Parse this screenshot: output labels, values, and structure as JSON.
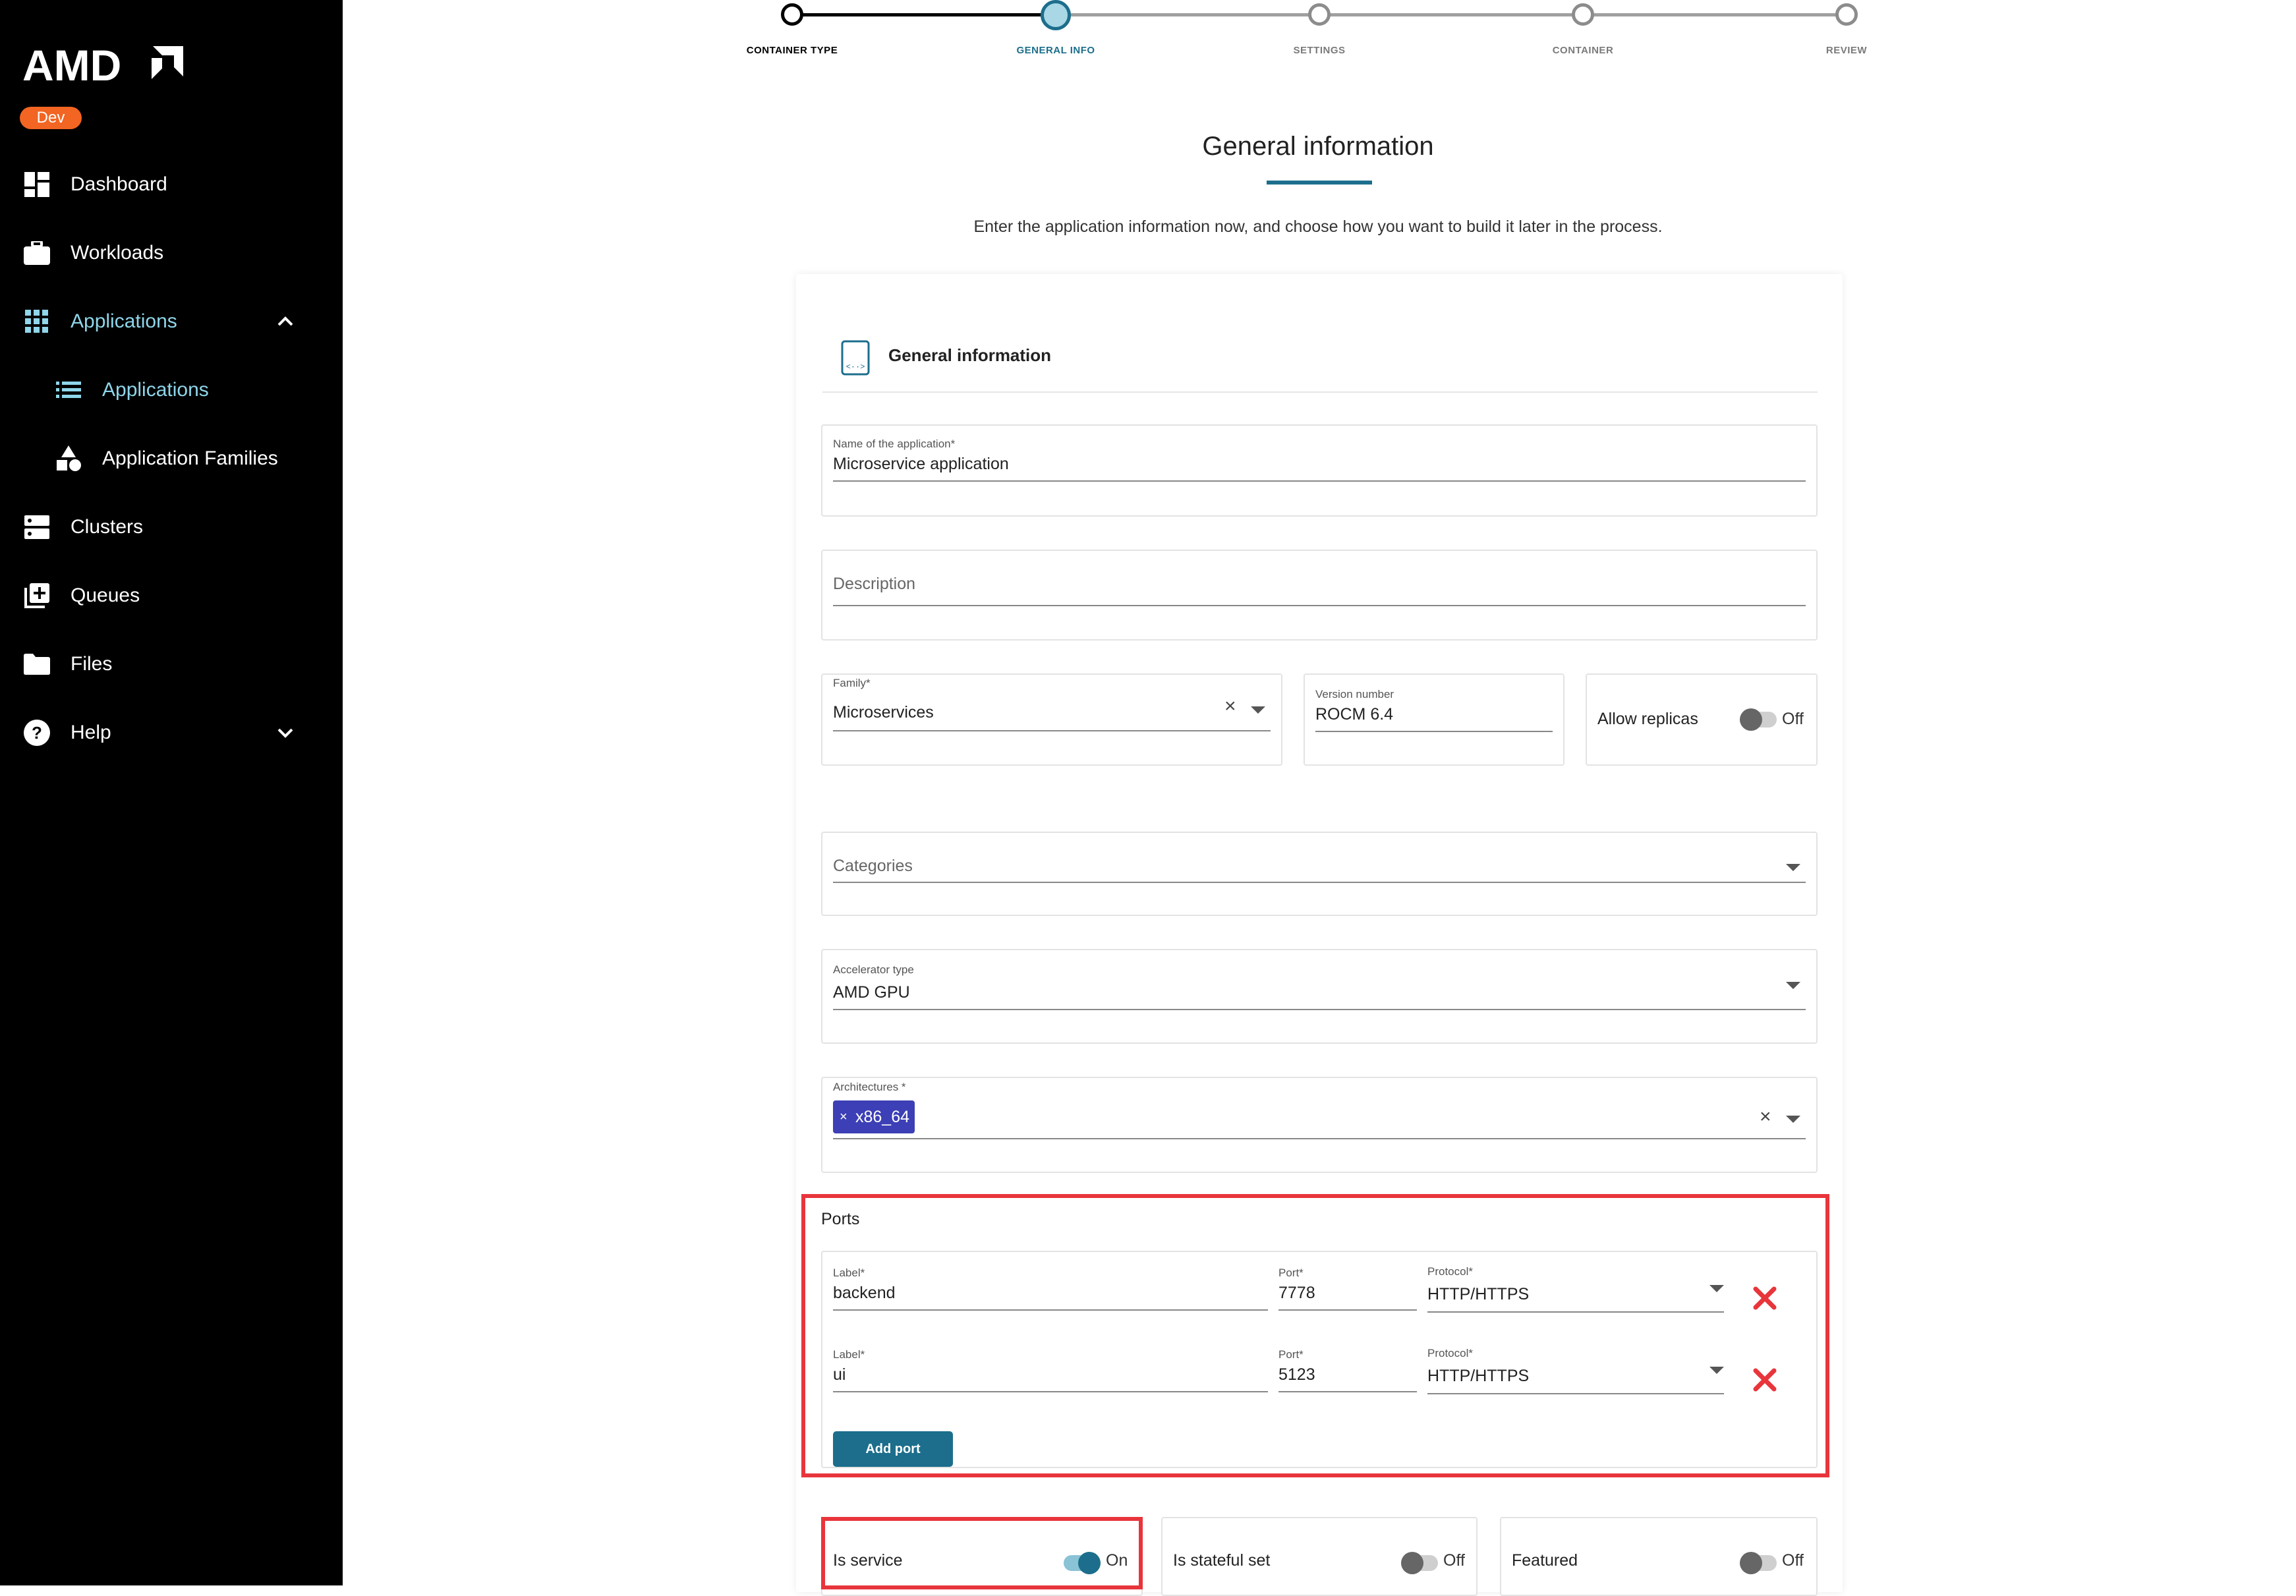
{
  "brand": {
    "logo_text": "AMD",
    "env_badge": "Dev"
  },
  "sidebar": {
    "items": [
      {
        "label": "Dashboard",
        "icon": "dashboard-icon"
      },
      {
        "label": "Workloads",
        "icon": "briefcase-icon"
      },
      {
        "label": "Applications",
        "icon": "apps-grid-icon",
        "expanded": true
      },
      {
        "label": "Applications",
        "icon": "list-icon",
        "active": true
      },
      {
        "label": "Application Families",
        "icon": "shapes-icon"
      },
      {
        "label": "Clusters",
        "icon": "server-icon"
      },
      {
        "label": "Queues",
        "icon": "queue-add-icon"
      },
      {
        "label": "Files",
        "icon": "folder-icon"
      },
      {
        "label": "Help",
        "icon": "help-circle-icon",
        "expanded": false
      }
    ]
  },
  "stepper": {
    "steps": [
      "CONTAINER TYPE",
      "GENERAL INFO",
      "SETTINGS",
      "CONTAINER",
      "REVIEW"
    ],
    "current_index": 1
  },
  "page": {
    "title": "General information",
    "subtitle": "Enter the application information now, and choose how you want to build it later in the process."
  },
  "form": {
    "section_title": "General information",
    "name": {
      "label": "Name of the application*",
      "value": "Microservice application"
    },
    "description": {
      "placeholder": "Description",
      "value": ""
    },
    "family": {
      "label": "Family*",
      "value": "Microservices"
    },
    "version": {
      "label": "Version number",
      "value": "ROCM 6.4"
    },
    "allow_replicas": {
      "label": "Allow replicas",
      "state": "Off",
      "on": false
    },
    "categories": {
      "placeholder": "Categories",
      "value": ""
    },
    "accelerator": {
      "label": "Accelerator type",
      "value": "AMD GPU"
    },
    "architectures": {
      "label": "Architectures *",
      "chips": [
        "x86_64"
      ]
    },
    "ports": {
      "title": "Ports",
      "rows": [
        {
          "label_label": "Label*",
          "label_value": "backend",
          "port_label": "Port*",
          "port_value": "7778",
          "protocol_label": "Protocol*",
          "protocol_value": "HTTP/HTTPS"
        },
        {
          "label_label": "Label*",
          "label_value": "ui",
          "port_label": "Port*",
          "port_value": "5123",
          "protocol_label": "Protocol*",
          "protocol_value": "HTTP/HTTPS"
        }
      ],
      "add_label": "Add port"
    },
    "is_service": {
      "label": "Is service",
      "state": "On",
      "on": true
    },
    "is_stateful_set": {
      "label": "Is stateful set",
      "state": "Off",
      "on": false
    },
    "featured": {
      "label": "Featured",
      "state": "Off",
      "on": false
    }
  },
  "colors": {
    "accent": "#1c6e8c",
    "highlight": "#e8353b",
    "chip": "#3c3fb5",
    "badge": "#f26522",
    "delete": "#e8353b"
  }
}
